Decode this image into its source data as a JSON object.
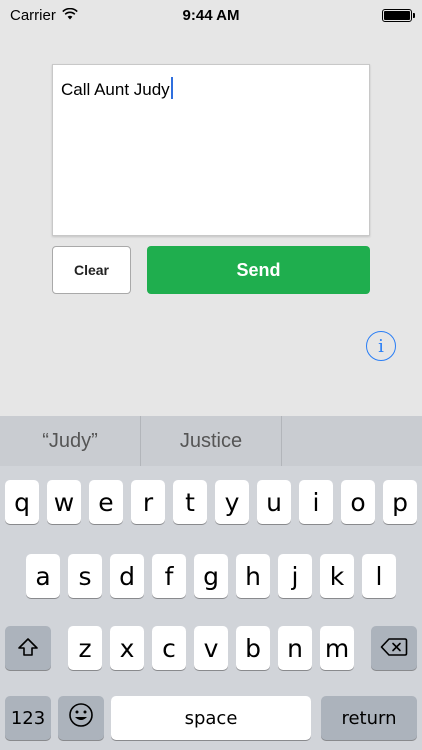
{
  "status_bar": {
    "carrier": "Carrier",
    "time": "9:44 AM",
    "battery_level": 1.0
  },
  "message_field": {
    "text": "Call Aunt Judy"
  },
  "actions": {
    "clear_label": "Clear",
    "send_label": "Send",
    "send_color": "#1fae4e",
    "info_glyph": "i",
    "info_color": "#2a7ef5"
  },
  "keyboard": {
    "suggestions": [
      "“Judy”",
      "Justice",
      ""
    ],
    "row1": [
      "q",
      "w",
      "e",
      "r",
      "t",
      "y",
      "u",
      "i",
      "o",
      "p"
    ],
    "row2": [
      "a",
      "s",
      "d",
      "f",
      "g",
      "h",
      "j",
      "k",
      "l"
    ],
    "row3": [
      "z",
      "x",
      "c",
      "v",
      "b",
      "n",
      "m"
    ],
    "shift_icon": "shift-icon",
    "delete_icon": "delete-icon",
    "numbers_label": "123",
    "emoji_icon": "emoji-icon",
    "space_label": "space",
    "return_label": "return"
  }
}
